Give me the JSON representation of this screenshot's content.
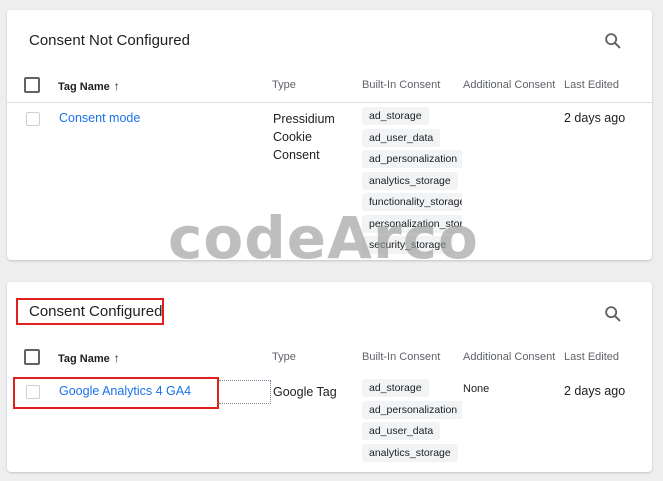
{
  "panels": [
    {
      "title": "Consent Not Configured",
      "headers": {
        "tag_name": "Tag Name",
        "sort_arrow": "🡡",
        "type": "Type",
        "built_in_consent": "Built-In Consent",
        "additional_consent": "Additional Consent",
        "last_edited": "Last Edited"
      },
      "rows": [
        {
          "name": "Consent mode",
          "type_lines": [
            "Pressidium",
            "Cookie",
            "Consent"
          ],
          "built_in_consent": [
            "ad_storage",
            "ad_user_data",
            "ad_personalization",
            "analytics_storage",
            "functionality_storage",
            "personalization_storage",
            "security_storage"
          ],
          "additional_consent": "",
          "last_edited": "2 days ago"
        }
      ]
    },
    {
      "title": "Consent Configured",
      "headers": {
        "tag_name": "Tag Name",
        "sort_arrow": "🡡",
        "type": "Type",
        "built_in_consent": "Built-In Consent",
        "additional_consent": "Additional Consent",
        "last_edited": "Last Edited"
      },
      "rows": [
        {
          "name": "Google Analytics 4 GA4",
          "type_lines": [
            "Google Tag"
          ],
          "built_in_consent": [
            "ad_storage",
            "ad_personalization",
            "ad_user_data",
            "analytics_storage"
          ],
          "additional_consent": "None",
          "last_edited": "2 days ago"
        }
      ]
    }
  ],
  "watermark": "codeArco",
  "icons": {
    "search": "search-icon",
    "sort": "arrow-up-icon"
  },
  "colors": {
    "link": "#1a73e8",
    "highlight": "#e0201c",
    "chip_bg": "#f1f3f4"
  }
}
